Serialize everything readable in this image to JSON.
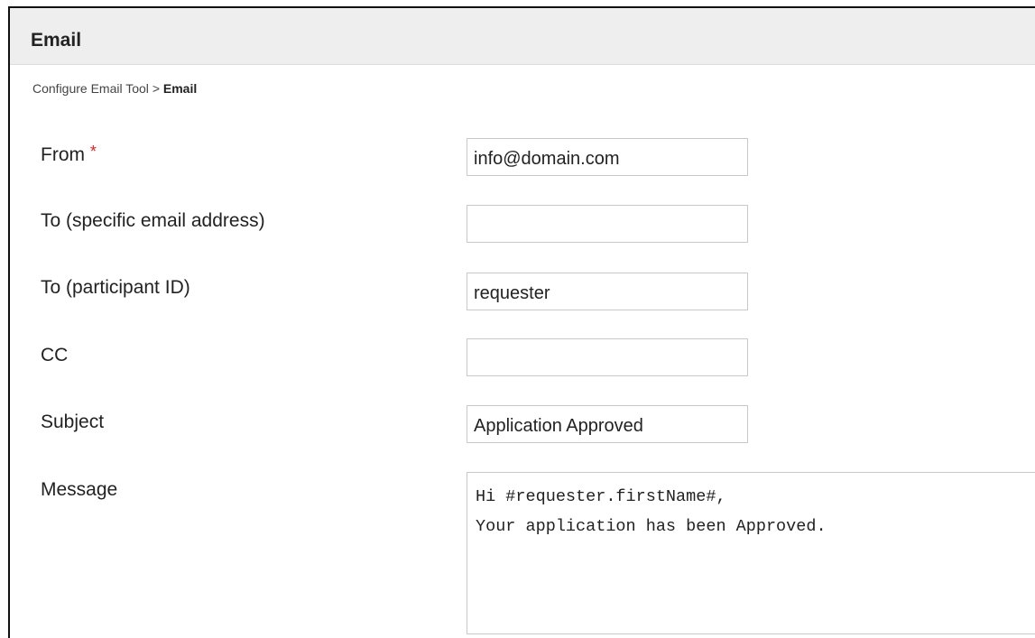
{
  "panel": {
    "title": "Email"
  },
  "breadcrumb": {
    "parent": "Configure Email Tool",
    "separator": ">",
    "current": "Email"
  },
  "form": {
    "from": {
      "label": "From",
      "required_mark": "*",
      "value": "info@domain.com"
    },
    "to_email": {
      "label": "To (specific email address)",
      "value": ""
    },
    "to_participant": {
      "label": "To (participant ID)",
      "value": "requester"
    },
    "cc": {
      "label": "CC",
      "value": ""
    },
    "subject": {
      "label": "Subject",
      "value": "Application Approved"
    },
    "message": {
      "label": "Message",
      "lines": [
        "Hi #requester.firstName#,",
        "",
        "Your application has been Approved."
      ]
    }
  },
  "colors": {
    "header_bg": "#eeeeee",
    "required": "#dd2222",
    "field_border": "#c9c9c9"
  }
}
